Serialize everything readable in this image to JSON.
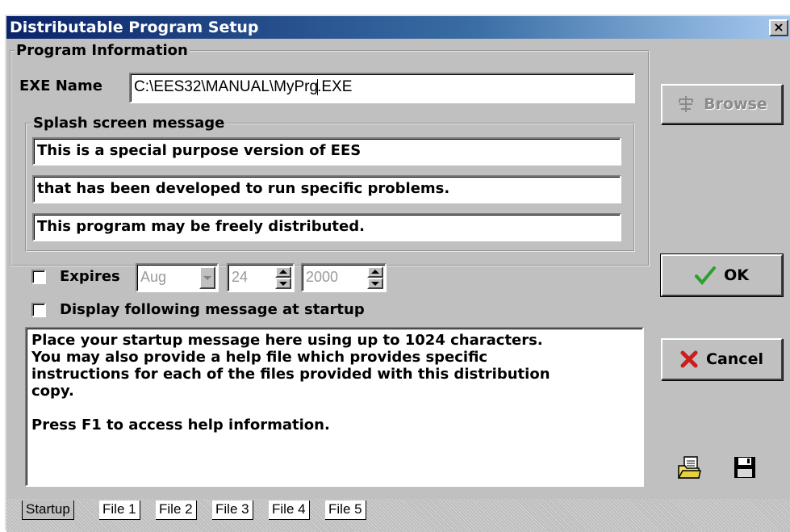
{
  "window": {
    "title": "Distributable Program Setup",
    "close_glyph": "×"
  },
  "program_info": {
    "legend": "Program Information",
    "exe_label": "EXE Name",
    "exe_value_before_caret": "C:\\EES32\\MANUAL\\MyPrg",
    "exe_value_after_caret": ".EXE"
  },
  "splash": {
    "legend": "Splash screen message",
    "lines": [
      "This is a special purpose version of EES",
      "that has been developed to run specific problems.",
      "This program may be freely distributed."
    ]
  },
  "expires": {
    "label": "Expires",
    "checked": false,
    "month": "Aug",
    "day": "24",
    "year": "2000"
  },
  "display_message": {
    "label": "Display following message at startup",
    "checked": false
  },
  "startup_message": {
    "lines": [
      "Place your startup message here using up to 1024 characters.",
      "You may also provide a help file which provides specific",
      "instructions for each of the files provided with this distribution",
      "copy."
    ],
    "help_line": "Press F1 to access help information."
  },
  "buttons": {
    "browse": "Browse",
    "ok": "OK",
    "cancel": "Cancel"
  },
  "icons": {
    "browse": "tree-icon",
    "ok": "checkmark-icon",
    "cancel": "x-icon",
    "open": "open-file-icon",
    "save": "floppy-disk-icon"
  },
  "colors": {
    "title_start": "#0a246a",
    "title_end": "#a6caf0",
    "face": "#c0c0c0",
    "ok_check": "#2e9e2e",
    "cancel_x": "#cc1c1c"
  },
  "tabs": [
    "Startup",
    "File 1",
    "File 2",
    "File 3",
    "File 4",
    "File 5"
  ]
}
